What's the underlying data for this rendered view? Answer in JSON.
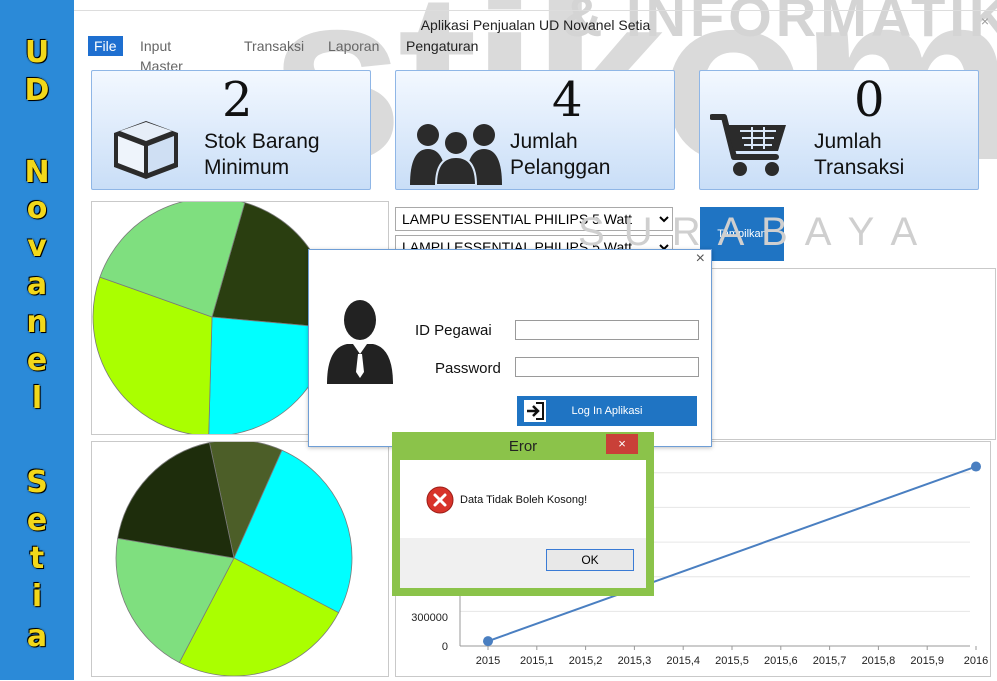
{
  "window": {
    "title": "Aplikasi Penjualan UD Novanel Setia",
    "close_glyph": "×"
  },
  "sidebar": {
    "letters": [
      "U",
      "D",
      "N",
      "o",
      "v",
      "a",
      "n",
      "e",
      "l",
      "S",
      "e",
      "t",
      "i",
      "a"
    ]
  },
  "watermark": {
    "logo": "stikom",
    "line1": "& INFORMATIK",
    "line2": "S U R A B A Y A"
  },
  "menu": {
    "items": [
      {
        "label": "File"
      },
      {
        "label": "Input Master"
      },
      {
        "label": "Transaksi"
      },
      {
        "label": "Laporan"
      },
      {
        "label": "Pengaturan"
      }
    ]
  },
  "cards": [
    {
      "count": "2",
      "line1": "Stok Barang",
      "line2": "Minimum",
      "icon": "box-icon"
    },
    {
      "count": "4",
      "line1": "Jumlah",
      "line2": "Pelanggan",
      "icon": "people-icon"
    },
    {
      "count": "0",
      "line1": "Jumlah",
      "line2": "Transaksi",
      "icon": "cart-icon"
    }
  ],
  "filters": {
    "product_1": "LAMPU ESSENTIAL PHILIPS 5 Watt",
    "product_2": "LAMPU ESSENTIAL PHILIPS 5 Watt",
    "show_button": "Tampilkan"
  },
  "login_dialog": {
    "id_label": "ID Pegawai",
    "password_label": "Password",
    "id_value": "",
    "password_value": "",
    "login_button": "Log In Aplikasi",
    "close_glyph": "×"
  },
  "error_dialog": {
    "title": "Eror",
    "message": "Data Tidak Boleh Kosong!",
    "ok_label": "OK",
    "close_glyph": "×"
  },
  "chart_data": [
    {
      "type": "pie",
      "slices": [
        {
          "value": 22,
          "color": "#2a3e10"
        },
        {
          "value": 24,
          "color": "#00ffff"
        },
        {
          "value": 30,
          "color": "#aaff00"
        },
        {
          "value": 24,
          "color": "#7fdf7f"
        }
      ]
    },
    {
      "type": "pie",
      "slices": [
        {
          "value": 10,
          "color": "#4c5e28"
        },
        {
          "value": 26,
          "color": "#00ffff"
        },
        {
          "value": 25,
          "color": "#aaff00"
        },
        {
          "value": 20,
          "color": "#7fdf7f"
        },
        {
          "value": 19,
          "color": "#1e2d0c"
        }
      ]
    },
    {
      "type": "line",
      "x": [
        2015,
        2016
      ],
      "y": [
        50000,
        1850000
      ],
      "x_ticks": [
        "2015",
        "2015,1",
        "2015,2",
        "2015,3",
        "2015,4",
        "2015,5",
        "2015,6",
        "2015,7",
        "2015,8",
        "2015,9",
        "2016"
      ],
      "y_ticks": [
        "0",
        "300000"
      ],
      "y_tick_values": [
        0,
        300000
      ],
      "ylim": [
        0,
        2000000
      ],
      "xlim": [
        2015,
        2016
      ],
      "color": "#4a7fc1"
    }
  ]
}
